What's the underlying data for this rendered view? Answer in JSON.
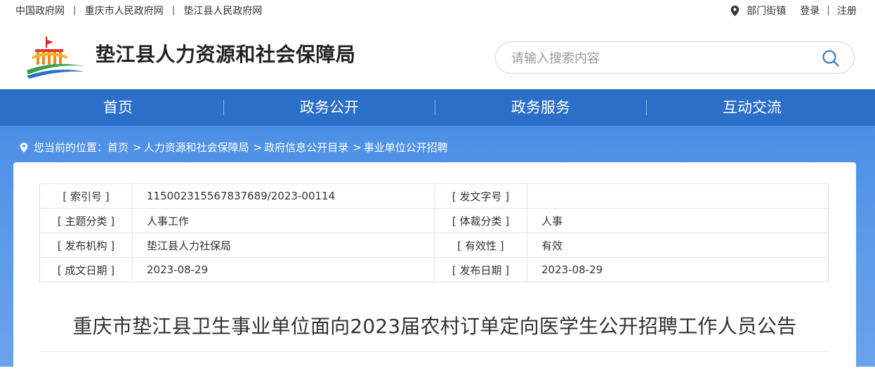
{
  "topbar": {
    "links": [
      "中国政府网",
      "重庆市人民政府网",
      "垫江县人民政府网"
    ],
    "dept_label": "部门街镇",
    "login": "登录",
    "register": "注册"
  },
  "header": {
    "title": "垫江县人力资源和社会保障局",
    "search_placeholder": "请输入搜索内容"
  },
  "nav": {
    "items": [
      "首页",
      "政务公开",
      "政务服务",
      "互动交流"
    ]
  },
  "breadcrumb": {
    "prefix": "您当前的位置：",
    "items": [
      "首页",
      "人力资源和社会保障局",
      "政府信息公开目录",
      "事业单位公开招聘"
    ]
  },
  "meta": {
    "index_label": "[ 索引号 ]",
    "index_value": "11500231556783768‌9/2023-00114",
    "doc_no_label": "[ 发文字号 ]",
    "doc_no_value": "",
    "topic_label": "[ 主题分类 ]",
    "topic_value": "人事工作",
    "genre_label": "[ 体裁分类 ]",
    "genre_value": "人事",
    "org_label": "[ 发布机构 ]",
    "org_value": "垫江县人力社保局",
    "validity_label": "[ 有效性 ]",
    "validity_value": "有效",
    "created_label": "[ 成文日期 ]",
    "created_value": "2023-08-29",
    "published_label": "[ 发布日期 ]",
    "published_value": "2023-08-29"
  },
  "document": {
    "title": "重庆市垫江县卫生事业单位面向2023届农村订单定向医学生公开招聘工作人员公告"
  },
  "colors": {
    "nav_blue": "#2c6fc9",
    "bg_blue": "#5a99e9"
  }
}
